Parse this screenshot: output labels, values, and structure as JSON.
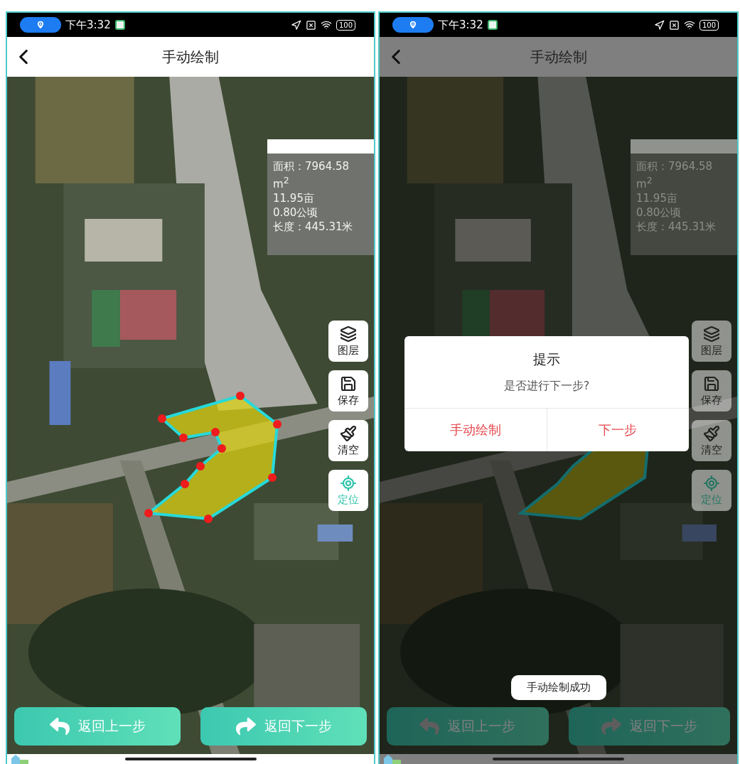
{
  "screens": [
    {
      "dimmed": false,
      "status_bar": {
        "time": "下午3:32",
        "battery": "100"
      },
      "header": {
        "title": "手动绘制"
      },
      "info_panel": {
        "lines": [
          "面积：7964.58",
          "m$^{2}$",
          "11.95亩",
          "0.80公顷",
          "长度：445.31米"
        ]
      },
      "drawing": {
        "vertices_visible": true
      },
      "tools": [
        {
          "kind": "layers",
          "label": "图层",
          "active": false
        },
        {
          "kind": "save",
          "label": "保存",
          "active": false
        },
        {
          "kind": "clear",
          "label": "清空",
          "active": false
        },
        {
          "kind": "locate",
          "label": "定位",
          "active": true
        }
      ],
      "buttons": [
        {
          "kind": "back",
          "label": "返回上一步"
        },
        {
          "kind": "forward",
          "label": "返回下一步"
        }
      ]
    },
    {
      "dimmed": true,
      "status_bar": {
        "time": "下午3:32",
        "battery": "100"
      },
      "header": {
        "title": "手动绘制"
      },
      "info_panel": {
        "lines": [
          "面积：7964.58",
          "m$^{2}$",
          "11.95亩",
          "0.80公顷",
          "长度：445.31米"
        ]
      },
      "drawing": {
        "vertices_visible": false
      },
      "tools": [
        {
          "kind": "layers",
          "label": "图层",
          "active": false
        },
        {
          "kind": "save",
          "label": "保存",
          "active": false
        },
        {
          "kind": "clear",
          "label": "清空",
          "active": false
        },
        {
          "kind": "locate",
          "label": "定位",
          "active": true
        }
      ],
      "buttons": [
        {
          "kind": "back",
          "label": "返回上一步"
        },
        {
          "kind": "forward",
          "label": "返回下一步"
        }
      ],
      "dialog": {
        "title": "提示",
        "message": "是否进行下一步?",
        "actions": [
          "手动绘制",
          "下一步"
        ]
      },
      "toast": "手动绘制成功"
    }
  ]
}
